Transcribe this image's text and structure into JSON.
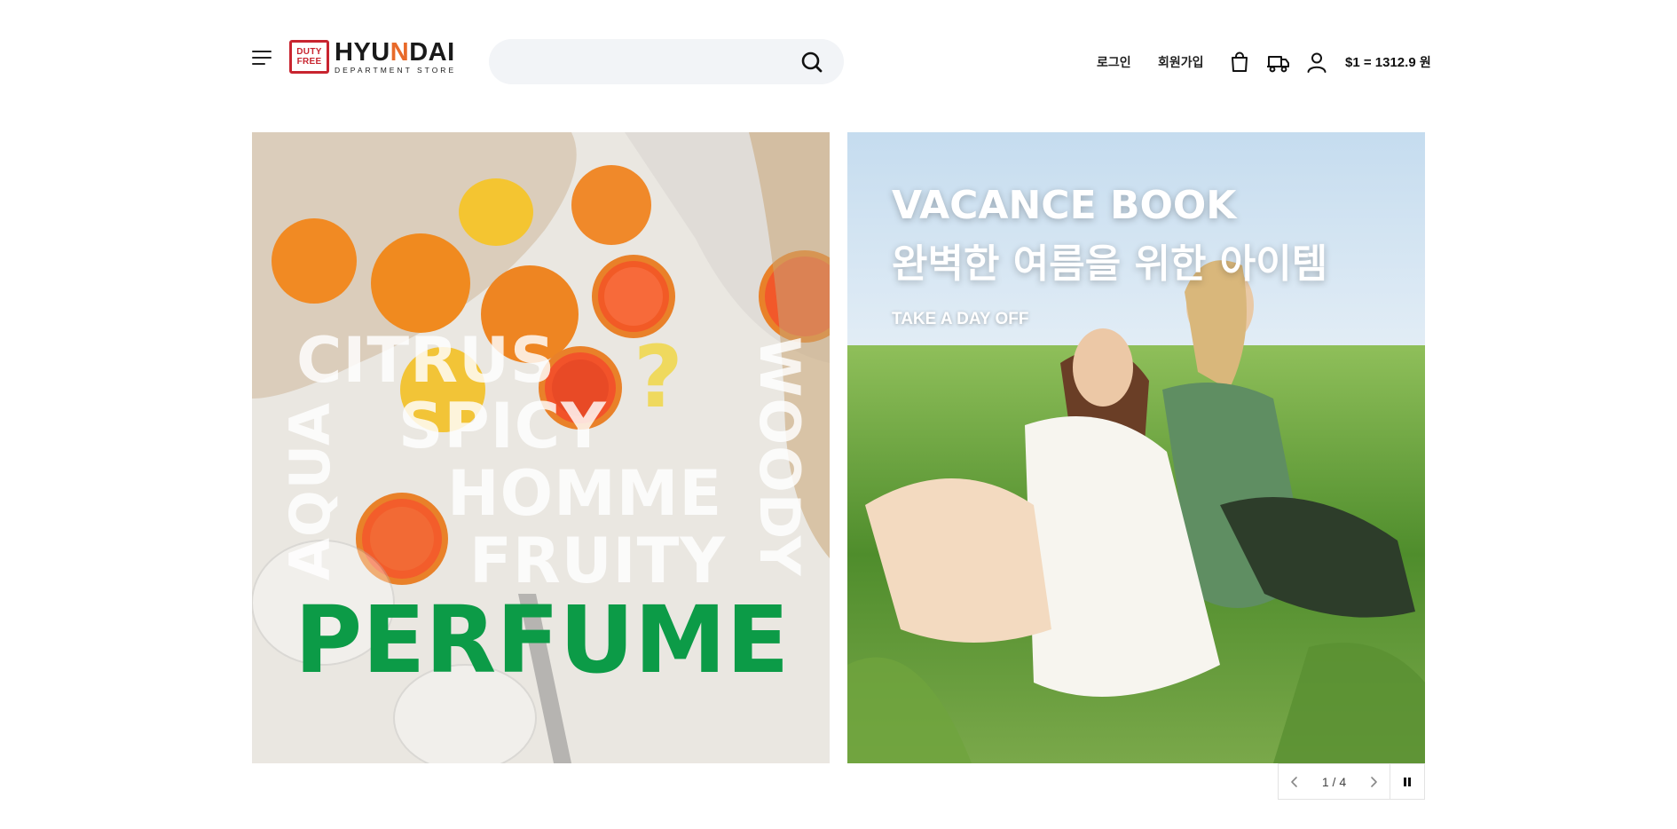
{
  "header": {
    "menu_icon": "hamburger-menu-icon",
    "logo": {
      "badge_line1": "DUTY",
      "badge_line2": "FREE",
      "main_left": "HYU",
      "main_mark": "N",
      "main_right": "DAI",
      "sub": "DEPARTMENT STORE",
      "brand_color": "#c8242f",
      "accent_color": "#e86a2a"
    },
    "search": {
      "placeholder": "",
      "value": "",
      "icon": "search-icon",
      "background": "#f2f4f7"
    },
    "utility": {
      "login_label": "로그인",
      "signup_label": "회원가입",
      "cart_icon": "shopping-bag-icon",
      "delivery_icon": "delivery-cart-icon",
      "mypage_icon": "user-icon",
      "rate_label": "$1 = 1312.9",
      "rate_unit": "원"
    }
  },
  "banners": [
    {
      "words": {
        "citrus": "CITRUS",
        "spicy": "SPICY",
        "homme": "HOMME",
        "fruity": "FRUITY",
        "aqua": "AQUA",
        "woody": "WOODY",
        "question": "?",
        "perfume": "PERFUME"
      },
      "perfume_color": "#0c9b47"
    },
    {
      "title_line1": "VACANCE BOOK",
      "title_line2": "완벽한 여름을 위한 아이템",
      "subtitle": "TAKE A DAY OFF"
    }
  ],
  "slider": {
    "prev_icon": "chevron-left-icon",
    "counter": "1 / 4",
    "next_icon": "chevron-right-icon",
    "pause_icon": "pause-icon"
  }
}
